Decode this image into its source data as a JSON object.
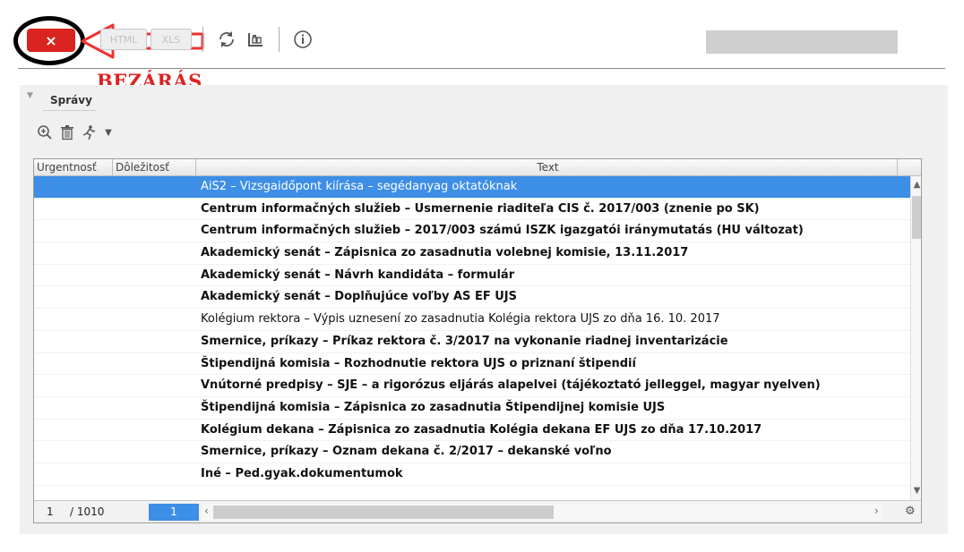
{
  "toolbar": {
    "close_label": "×",
    "html_label": "HTML",
    "xls_label": "XLS",
    "refresh_icon": "refresh-icon",
    "columns_icon": "columns-icon",
    "info_icon": "info-icon"
  },
  "annotation": {
    "label": "BEZÁRÁS",
    "color": "#dd2222"
  },
  "panel": {
    "title": "Správy"
  },
  "table": {
    "columns": [
      "Urgentnosť",
      "Dôležitosť",
      "Text"
    ],
    "rows": [
      {
        "text": "AiS2 – Vizsgaidőpont kiírása – segédanyag oktatóknak",
        "bold": false,
        "selected": true
      },
      {
        "text": "Centrum informačných služieb – Usmernenie riaditeľa CIS č. 2017/003 (znenie po SK)",
        "bold": true,
        "selected": false
      },
      {
        "text": "Centrum informačných služieb – 2017/003 számú ISZK igazgatói iránymutatás (HU változat)",
        "bold": true,
        "selected": false
      },
      {
        "text": "Akademický senát – Zápisnica zo zasadnutia volebnej komisie, 13.11.2017",
        "bold": true,
        "selected": false
      },
      {
        "text": "Akademický senát – Návrh kandidáta – formulár",
        "bold": true,
        "selected": false
      },
      {
        "text": "Akademický senát – Doplňujúce voľby AS EF UJS",
        "bold": true,
        "selected": false
      },
      {
        "text": "Kolégium rektora – Výpis uznesení zo zasadnutia Kolégia rektora UJS zo dňa 16. 10. 2017",
        "bold": false,
        "selected": false
      },
      {
        "text": "Smernice, príkazy – Príkaz rektora č. 3/2017 na vykonanie riadnej inventarizácie",
        "bold": true,
        "selected": false
      },
      {
        "text": "Štipendijná komisia – Rozhodnutie rektora UJS o priznaní štipendií",
        "bold": true,
        "selected": false
      },
      {
        "text": "Vnútorné predpisy – SJE – a rigorózus eljárás alapelvei (tájékoztató jelleggel, magyar nyelven)",
        "bold": true,
        "selected": false
      },
      {
        "text": "Štipendijná komisia – Zápisnica zo zasadnutia Štipendijnej komisie UJS",
        "bold": true,
        "selected": false
      },
      {
        "text": "Kolégium dekana – Zápisnica zo zasadnutia Kolégia dekana EF UJS zo dňa 17.10.2017",
        "bold": true,
        "selected": false
      },
      {
        "text": "Smernice, príkazy – Oznam dekana č. 2/2017 – dekanské voľno",
        "bold": true,
        "selected": false
      },
      {
        "text": "Iné – Ped.gyak.dokumentumok",
        "bold": true,
        "selected": false
      }
    ]
  },
  "pager": {
    "current": "1",
    "total": "/ 1010",
    "page_input": "1"
  },
  "colors": {
    "close_red": "#d9241f",
    "selection_blue": "#3d8ee6"
  }
}
